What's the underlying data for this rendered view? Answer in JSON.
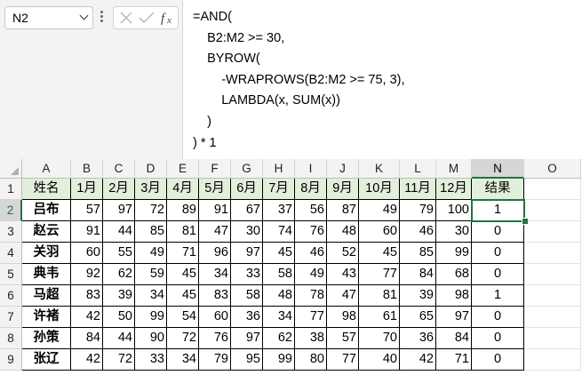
{
  "namebox": {
    "value": "N2"
  },
  "formula": {
    "lines": [
      "=AND(",
      "    B2:M2 >= 30,",
      "    BYROW(",
      "        -WRAPROWS(B2:M2 >= 75, 3),",
      "        LAMBDA(x, SUM(x))",
      "    )",
      ") * 1"
    ]
  },
  "icons": {
    "cancel": "close-icon",
    "confirm": "check-icon",
    "insert_function": "fx-icon",
    "namebox_dropdown": "chevron-down-icon"
  },
  "colors": {
    "header_fill": "#e2efda",
    "selection": "#217346"
  },
  "grid": {
    "columns": [
      "A",
      "B",
      "C",
      "D",
      "E",
      "F",
      "G",
      "H",
      "I",
      "J",
      "K",
      "L",
      "M",
      "N",
      "O"
    ],
    "rows": [
      "1",
      "2",
      "3",
      "4",
      "5",
      "6",
      "7",
      "8",
      "9"
    ],
    "selected_column": "N",
    "selected_row": "2",
    "header": [
      "姓名",
      "1月",
      "2月",
      "3月",
      "4月",
      "5月",
      "6月",
      "7月",
      "8月",
      "9月",
      "10月",
      "11月",
      "12月",
      "结果"
    ],
    "data": [
      {
        "name": "吕布",
        "values": [
          "57",
          "97",
          "72",
          "89",
          "91",
          "67",
          "37",
          "56",
          "87",
          "49",
          "79",
          "100"
        ],
        "result": "1"
      },
      {
        "name": "赵云",
        "values": [
          "91",
          "44",
          "85",
          "81",
          "47",
          "30",
          "74",
          "76",
          "48",
          "60",
          "46",
          "30"
        ],
        "result": "0"
      },
      {
        "name": "关羽",
        "values": [
          "60",
          "55",
          "49",
          "71",
          "96",
          "97",
          "45",
          "46",
          "52",
          "45",
          "85",
          "99"
        ],
        "result": "0"
      },
      {
        "name": "典韦",
        "values": [
          "92",
          "62",
          "59",
          "45",
          "34",
          "33",
          "58",
          "49",
          "43",
          "77",
          "84",
          "68"
        ],
        "result": "0"
      },
      {
        "name": "马超",
        "values": [
          "83",
          "39",
          "34",
          "45",
          "83",
          "58",
          "48",
          "78",
          "47",
          "81",
          "39",
          "98"
        ],
        "result": "1"
      },
      {
        "name": "许褚",
        "values": [
          "42",
          "50",
          "99",
          "54",
          "60",
          "36",
          "34",
          "77",
          "98",
          "61",
          "65",
          "97"
        ],
        "result": "0"
      },
      {
        "name": "孙策",
        "values": [
          "84",
          "44",
          "90",
          "72",
          "76",
          "97",
          "62",
          "38",
          "57",
          "70",
          "36",
          "84"
        ],
        "result": "0"
      },
      {
        "name": "张辽",
        "values": [
          "42",
          "72",
          "33",
          "34",
          "79",
          "95",
          "99",
          "80",
          "77",
          "40",
          "42",
          "71"
        ],
        "result": "0"
      }
    ]
  }
}
